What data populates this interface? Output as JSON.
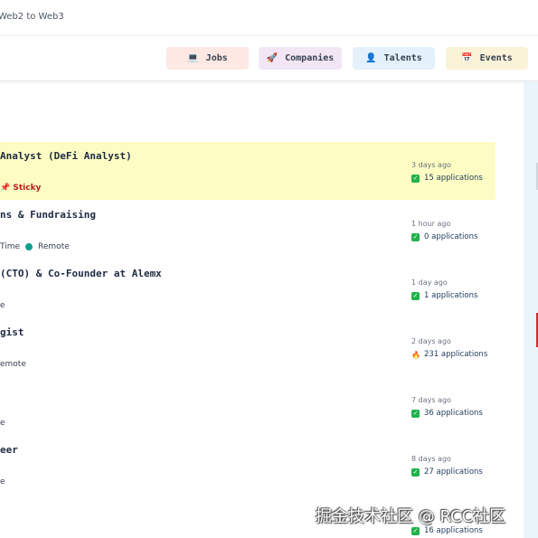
{
  "header": {
    "title": "Web2 to Web3"
  },
  "nav": [
    {
      "label": "Jobs",
      "icon": "laptop-icon"
    },
    {
      "label": "Companies",
      "icon": "rocket-icon"
    },
    {
      "label": "Talents",
      "icon": "person-icon"
    },
    {
      "label": "Events",
      "icon": "calendar-icon"
    }
  ],
  "colors": {
    "jobs_bg": "#fde8e4",
    "companies_bg": "#f2e6f5",
    "talents_bg": "#e4f1fb",
    "events_bg": "#fbf3d7",
    "sticky_bg": "#fdfdc3"
  },
  "jobs": [
    {
      "title": "Analyst (DeFi Analyst)",
      "tags": [
        "Sticky"
      ],
      "posted": "3 days ago",
      "applications": "15 applications"
    },
    {
      "title": "ns & Fundraising",
      "tags": [
        "Time",
        "Remote"
      ],
      "posted": "1 hour ago",
      "applications": "0 applications"
    },
    {
      "title": "(CTO) & Co-Founder at Alemx",
      "tags": [
        "e"
      ],
      "posted": "1 day ago",
      "applications": "1 applications"
    },
    {
      "title": "gist",
      "tags": [
        "emote"
      ],
      "posted": "2 days ago",
      "applications": "231 applications"
    },
    {
      "title": "",
      "tags": [
        "e"
      ],
      "posted": "7 days ago",
      "applications": "36 applications"
    },
    {
      "title": "eer",
      "tags": [
        "e"
      ],
      "posted": "8 days ago",
      "applications": "27 applications"
    },
    {
      "title": "",
      "tags": [],
      "posted": "",
      "applications": "16 applications"
    }
  ],
  "watermark": "掘金技术社区 @ RCC社区"
}
